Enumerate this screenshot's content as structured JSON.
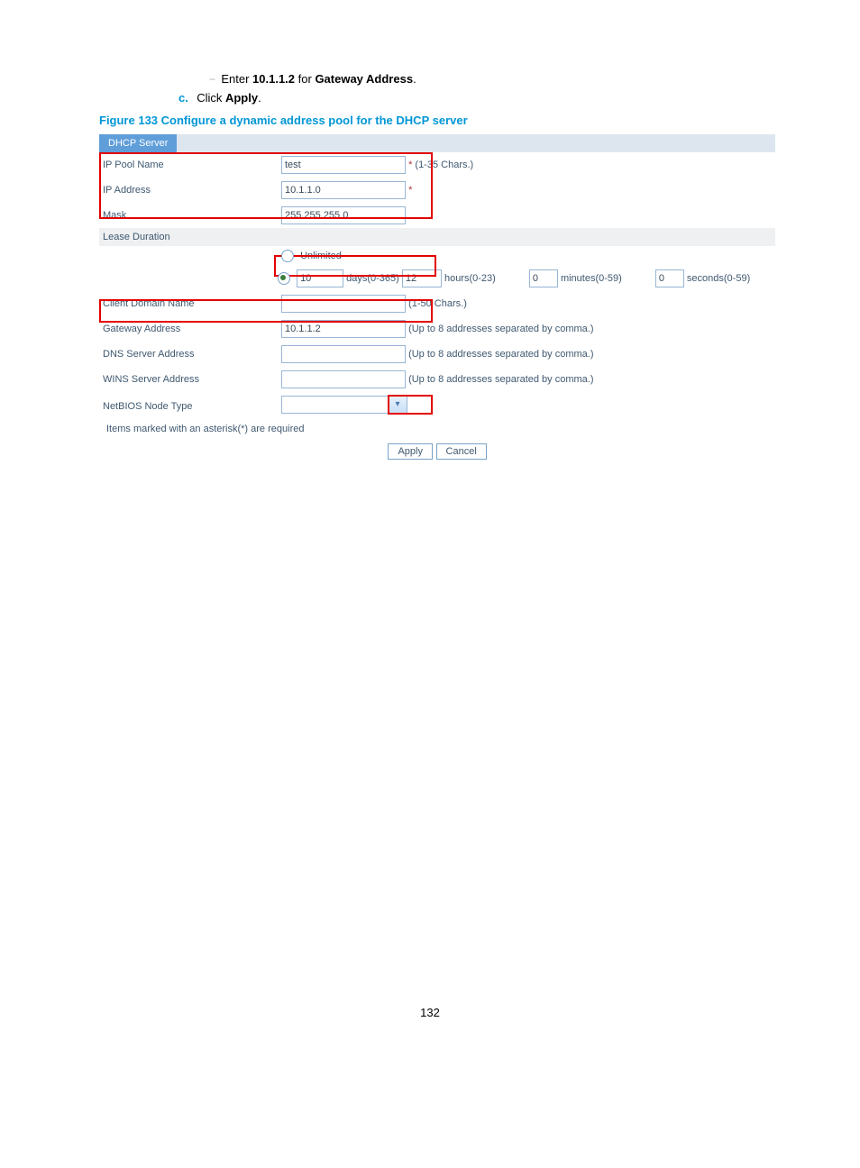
{
  "step_sub": {
    "instr_prefix": "Enter ",
    "value": "10.1.1.2",
    "instr_middle": " for ",
    "field_name": "Gateway Address",
    "instr_suffix": "."
  },
  "step_c": {
    "marker": "c.",
    "instr_prefix": "Click ",
    "btn": "Apply",
    "instr_suffix": "."
  },
  "figure_caption": "Figure 133 Configure a dynamic address pool for the DHCP server",
  "tab_title": "DHCP Server",
  "labels": {
    "ip_pool_name": "IP Pool Name",
    "ip_address": "IP Address",
    "mask": "Mask",
    "lease_duration": "Lease Duration",
    "unlimited": "Unlimited",
    "days": "days(0-365)",
    "hours": "hours(0-23)",
    "minutes": "minutes(0-59)",
    "seconds": "seconds(0-59)",
    "client_domain": "Client Domain Name",
    "gateway": "Gateway Address",
    "dns": "DNS Server Address",
    "wins": "WINS Server Address",
    "netbios": "NetBIOS Node Type"
  },
  "hints": {
    "pool_name": "(1-35 Chars.)",
    "star": "*",
    "client_domain": "(1-50 Chars.)",
    "upto8": "(Up to 8 addresses separated by comma.)"
  },
  "values": {
    "pool_name": "test",
    "ip_address": "10.1.1.0",
    "mask": "255.255.255.0",
    "days": "10",
    "hours": "12",
    "minutesB": "0",
    "secondsB": "0",
    "gateway": "10.1.1.2"
  },
  "footer_note": "Items marked with an asterisk(*) are required",
  "buttons": {
    "apply": "Apply",
    "cancel": "Cancel"
  },
  "page_number": "132"
}
